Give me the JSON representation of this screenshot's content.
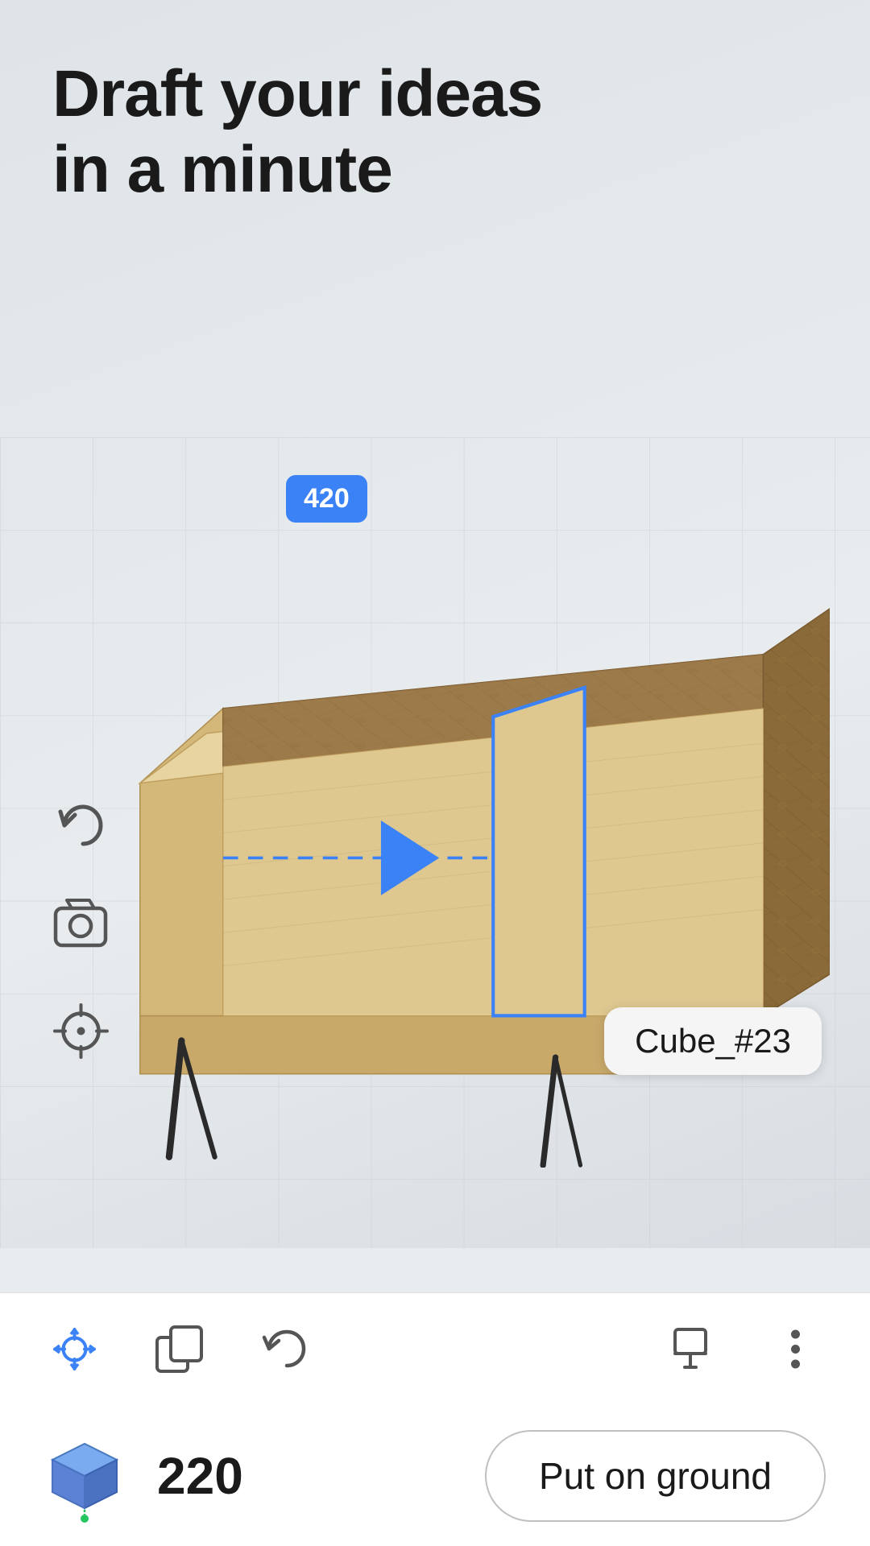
{
  "header": {
    "title_line1": "Draft your ideas",
    "title_line2": "in a minute"
  },
  "viewport": {
    "measurement": "420",
    "cube_label": "Cube_#23"
  },
  "toolbar": {
    "icons": [
      "move-icon",
      "duplicate-icon",
      "undo-icon",
      "paint-icon",
      "more-icon"
    ]
  },
  "bottom_bar": {
    "height_value": "220",
    "put_on_ground_label": "Put on ground"
  },
  "colors": {
    "blue": "#3b82f6",
    "dark": "#1a1a1a",
    "light_gray": "#e8ecee"
  }
}
